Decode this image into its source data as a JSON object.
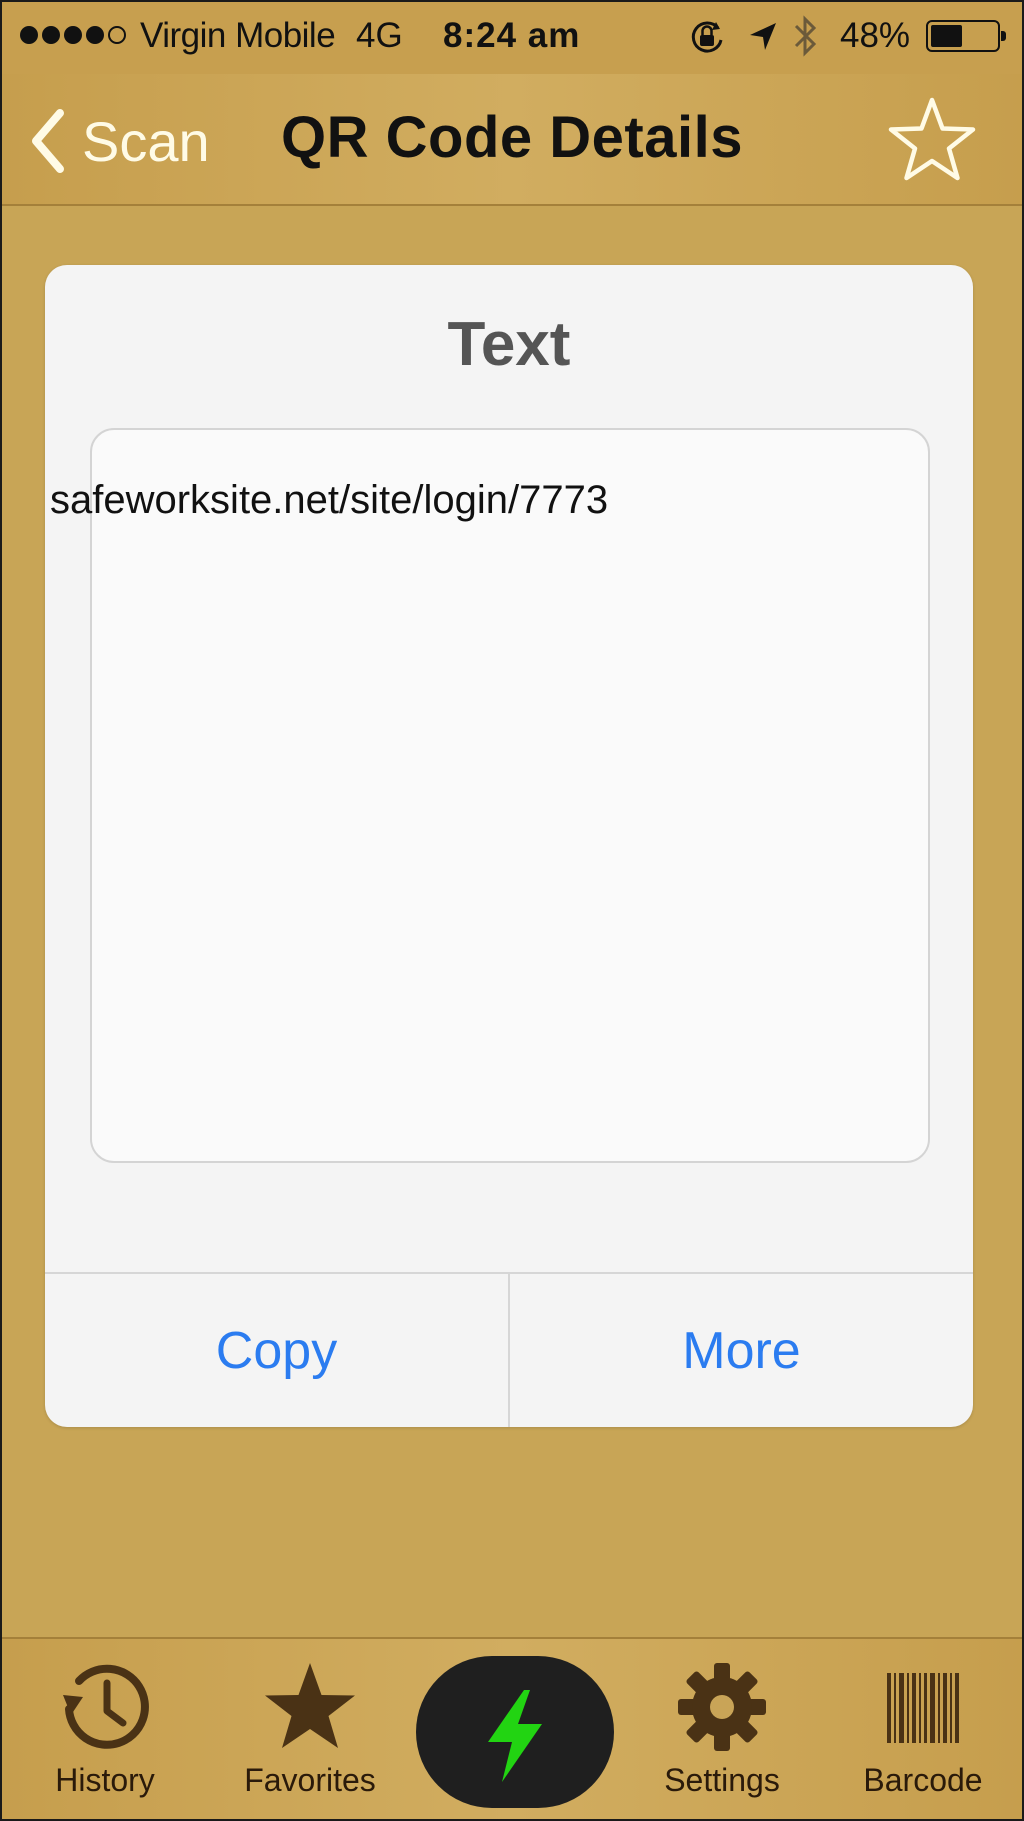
{
  "status_bar": {
    "carrier": "Virgin Mobile",
    "network": "4G",
    "time": "8:24 am",
    "battery_percent": "48%",
    "battery_level": 0.48,
    "signal_bars_filled": 4,
    "signal_bars_total": 5,
    "icons": [
      "orientation-lock-icon",
      "location-arrow-icon",
      "bluetooth-icon",
      "battery-icon"
    ]
  },
  "nav": {
    "back_label": "Scan",
    "title": "QR Code Details",
    "favorite_icon": "star-outline-icon"
  },
  "card": {
    "title": "Text",
    "content": "safeworksite.net/site/login/7773",
    "actions": [
      {
        "label": "Copy"
      },
      {
        "label": "More"
      }
    ]
  },
  "tab_bar": {
    "tabs": [
      {
        "label": "History",
        "icon": "history-clock-icon"
      },
      {
        "label": "Favorites",
        "icon": "star-filled-icon"
      },
      {
        "label": "",
        "icon": "lightning-bolt-icon"
      },
      {
        "label": "Settings",
        "icon": "gear-icon"
      },
      {
        "label": "Barcode",
        "icon": "barcode-icon"
      }
    ]
  },
  "colors": {
    "background": "#c8a556",
    "action_blue": "#2b7cf0",
    "scan_bolt": "#22d412",
    "tab_icon": "#4a3215"
  }
}
